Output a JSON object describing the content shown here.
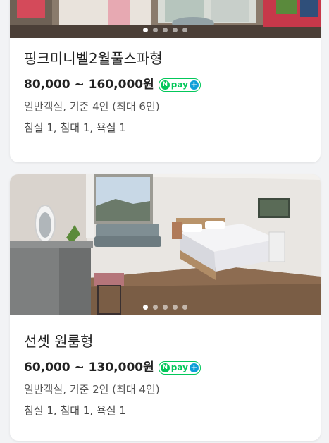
{
  "listings": [
    {
      "name": "핑크미니벨2월풀스파형",
      "price": "80,000 ~ 160,000원",
      "badge": {
        "n": "N",
        "text": "pay",
        "plus": "+"
      },
      "capacity": "일반객실, 기준 4인 (최대 6인)",
      "rooms": "침실 1, 침대 1, 욕실 1",
      "slide_count": 5,
      "active_slide": 1
    },
    {
      "name": "선셋 원룸형",
      "price": "60,000 ~ 130,000원",
      "badge": {
        "n": "N",
        "text": "pay",
        "plus": "+"
      },
      "capacity": "일반객실, 기준 2인 (최대 4인)",
      "rooms": "침실 1, 침대 1, 욕실 1",
      "slide_count": 5,
      "active_slide": 1
    }
  ],
  "colors": {
    "naver_pay_green": "#03c75a",
    "plus_blue": "#0d9fd8"
  }
}
